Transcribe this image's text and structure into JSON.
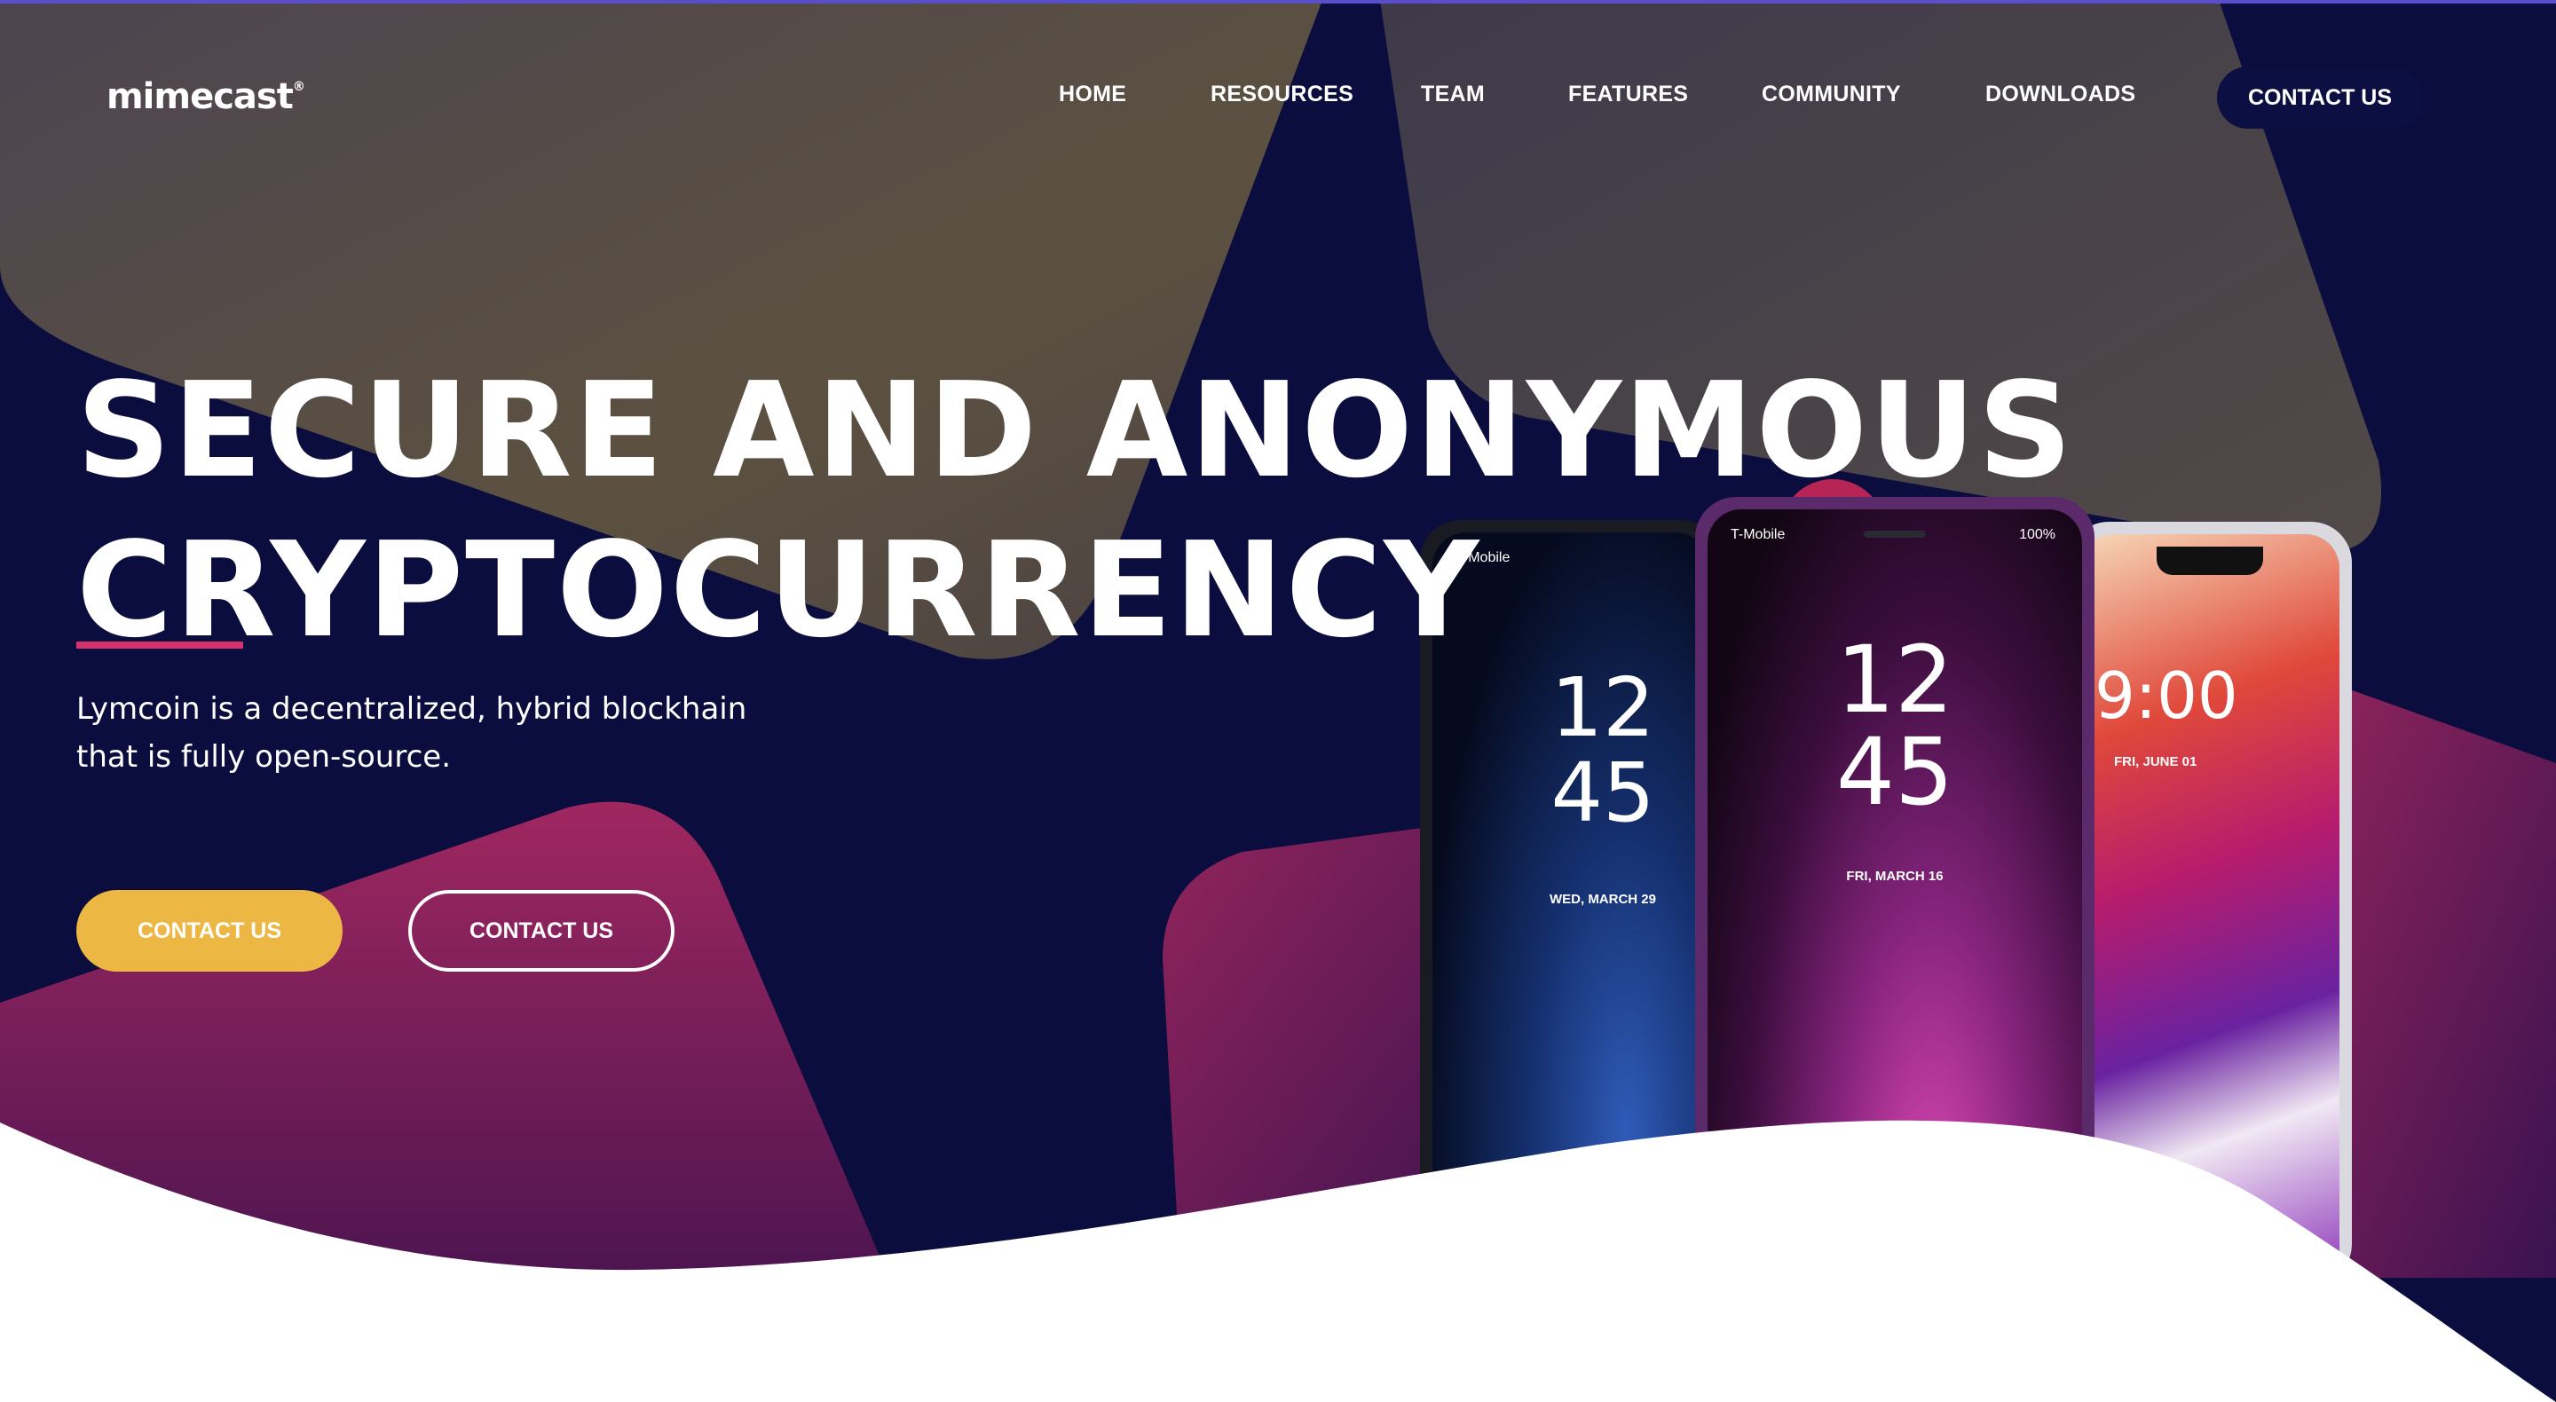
{
  "brand": {
    "logo_text": "mimecast",
    "logo_mark": "®"
  },
  "nav": {
    "items": [
      {
        "label": "HOME"
      },
      {
        "label": "RESOURCES"
      },
      {
        "label": "TEAM"
      },
      {
        "label": "FEATURES"
      },
      {
        "label": "COMMUNITY"
      },
      {
        "label": "DOWNLOADS"
      }
    ],
    "contact_label": "CONTACT US"
  },
  "hero": {
    "title_line1": "SECURE AND ANONYMOUS",
    "title_line2": "CRYPTOCURRENCY",
    "subtitle": "Lymcoin is a decentralized, hybrid blockhain that is fully open-source.",
    "primary_button": "CONTACT US",
    "secondary_button": "CONTACT US"
  },
  "phones": {
    "phone1": {
      "carrier": "T-Mobile",
      "hours": "12",
      "minutes": "45",
      "date": "WED, MARCH 29"
    },
    "phone2": {
      "carrier": "T-Mobile",
      "status": "100%",
      "hours": "12",
      "minutes": "45",
      "date": "FRI, MARCH 16"
    },
    "phone3": {
      "time": "9:00",
      "date": "FRI, JUNE 01"
    }
  },
  "colors": {
    "background": "#0b0d3e",
    "accent_yellow": "#edb743",
    "accent_pink": "#d6336c",
    "text": "#ffffff"
  }
}
